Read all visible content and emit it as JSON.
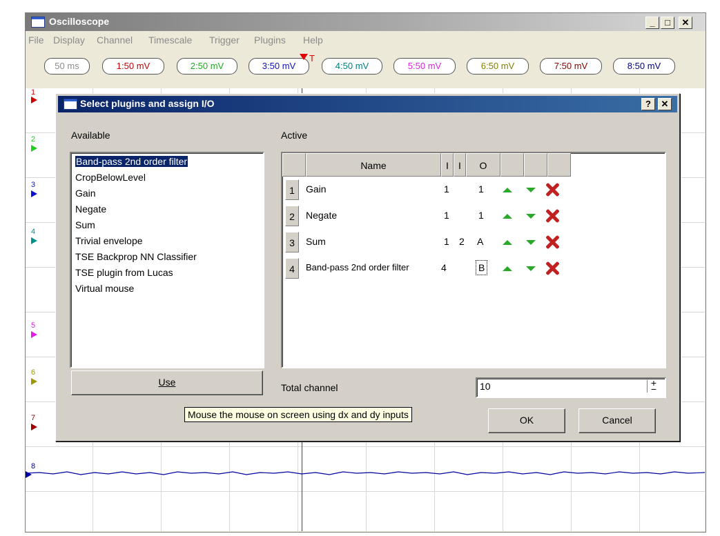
{
  "main": {
    "title": "Oscilloscope",
    "controls": {
      "min": "_",
      "max": "□",
      "close": "✕"
    }
  },
  "menu": [
    "File",
    "Display",
    "Channel",
    "Timescale",
    "Trigger",
    "Plugins",
    "Help"
  ],
  "trigger_label": "T",
  "scales": [
    {
      "label": "50 ms",
      "color": "#8b8b8b"
    },
    {
      "label": "1:50 mV",
      "color": "#c00000"
    },
    {
      "label": "2:50 mV",
      "color": "#22aa22"
    },
    {
      "label": "3:50 mV",
      "color": "#1010c0"
    },
    {
      "label": "4:50 mV",
      "color": "#008080"
    },
    {
      "label": "5:50 mV",
      "color": "#e020e0"
    },
    {
      "label": "6:50 mV",
      "color": "#808000"
    },
    {
      "label": "7:50 mV",
      "color": "#8b0000"
    },
    {
      "label": "8:50 mV",
      "color": "#000080"
    }
  ],
  "channels": [
    {
      "n": "1",
      "color": "#d00000"
    },
    {
      "n": "2",
      "color": "#22cc22"
    },
    {
      "n": "3",
      "color": "#1010d0"
    },
    {
      "n": "4",
      "color": "#009090"
    },
    {
      "n": "5",
      "color": "#e020e0"
    },
    {
      "n": "6",
      "color": "#9a9a00"
    },
    {
      "n": "7",
      "color": "#a00000"
    },
    {
      "n": "8",
      "color": "#0000a0"
    }
  ],
  "dialog": {
    "title": "Select plugins and assign I/O",
    "help": "?",
    "close": "✕",
    "available_label": "Available",
    "active_label": "Active",
    "available": [
      "Band-pass 2nd order filter",
      "CropBelowLevel",
      "Gain",
      "Negate",
      "Sum",
      "Trivial envelope",
      "TSE Backprop NN Classifier",
      "TSE plugin from Lucas",
      "Virtual mouse"
    ],
    "use_button": "Use",
    "columns": [
      "Name",
      "I",
      "I",
      "O",
      "",
      "",
      ""
    ],
    "rows": [
      {
        "num": "1",
        "name": "Gain",
        "i1": "1",
        "i2": "",
        "o": "1"
      },
      {
        "num": "2",
        "name": "Negate",
        "i1": "1",
        "i2": "",
        "o": "1"
      },
      {
        "num": "3",
        "name": "Sum",
        "i1": "1",
        "i2": "2",
        "o": "A"
      },
      {
        "num": "4",
        "name": "Band-pass 2nd order filter",
        "i1": "4",
        "i2": "",
        "o": "B"
      }
    ],
    "total_channel_label": "Total channel",
    "total_channel_value": "10",
    "ok_button": "OK",
    "cancel_button": "Cancel",
    "tooltip": "Mouse the mouse on screen using dx and dy inputs"
  }
}
